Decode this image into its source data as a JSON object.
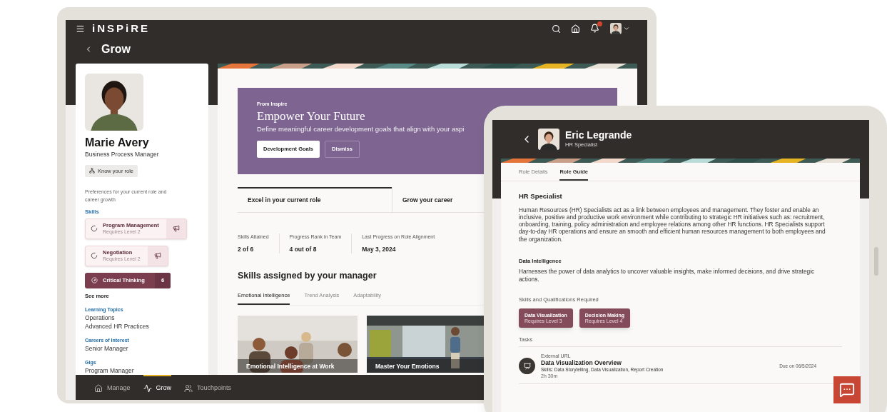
{
  "laptop": {
    "logo": "iNSPiRE",
    "page_title": "Grow",
    "profile": {
      "name": "Marie Avery",
      "job": "Business Process Manager",
      "role_button": "Know your role",
      "preferences_note": "Preferences for your current role and career growth",
      "skills_heading": "Skills",
      "skills": [
        {
          "kind": "pending",
          "name": "Program Management",
          "requirement": "Requires Level 2"
        },
        {
          "kind": "pending",
          "name": "Negotiation",
          "requirement": "Requires Level 2"
        },
        {
          "kind": "attained",
          "name": "Critical Thinking",
          "count": "6"
        }
      ],
      "see_more": "See more",
      "sections": [
        {
          "heading": "Learning Topics",
          "items": [
            "Operations",
            "Advanced HR Practices"
          ]
        },
        {
          "heading": "Careers of Interest",
          "items": [
            "Senior Manager"
          ]
        },
        {
          "heading": "Gigs",
          "items": [
            "Program Manager"
          ]
        }
      ]
    },
    "banner": {
      "eyebrow": "From Inspire",
      "title": "Empower Your Future",
      "text": "Define meaningful career development goals that align with your aspi",
      "primary_button": "Development Goals",
      "secondary_button": "Dismiss"
    },
    "role_tabs": [
      {
        "label": "Excel in your current role",
        "selected": true
      },
      {
        "label": "Grow your career",
        "selected": false
      }
    ],
    "stats": [
      {
        "label": "Skills Attained",
        "value": "2 of 6"
      },
      {
        "label": "Progress Rank in Team",
        "value": "4 out of 8"
      },
      {
        "label": "Last Progress on Role Alignment",
        "value": "May 3, 2024"
      }
    ],
    "skills_heading": "Skills assigned by your manager",
    "skill_tabs": [
      {
        "label": "Emotional Intelligence",
        "selected": true
      },
      {
        "label": "Trend Analysis",
        "selected": false
      },
      {
        "label": "Adaptability",
        "selected": false
      }
    ],
    "courses": [
      {
        "title": "Emotional Intelligence at Work"
      },
      {
        "title": "Master Your Emotions"
      }
    ],
    "bottom_nav": [
      {
        "kind": "manage",
        "label": "Manage",
        "selected": false
      },
      {
        "kind": "grow",
        "label": "Grow",
        "selected": true
      },
      {
        "kind": "touchpoints",
        "label": "Touchpoints",
        "selected": false
      }
    ]
  },
  "tablet": {
    "name": "Eric Legrande",
    "job": "HR Specialist",
    "tabs": [
      {
        "label": "Role Details",
        "selected": false
      },
      {
        "label": "Role Guide",
        "selected": true
      }
    ],
    "role_title": "HR Specialist",
    "role_description": "Human Resources (HR) Specialists act as a link between employees and management. They foster and enable an inclusive, positive and productive work environment while contributing to strategic HR initiatives such as: recruitment, onboarding, training, policy administration and employee relations among other HR functions. HR Specialists support day-to-day HR operations and ensure an smooth and efficient human resources management to both employees and the organization.",
    "sections": [
      {
        "heading": "Data Intelligence",
        "text": "Harnesses the power of data analytics to uncover valuable insights, make informed decisions, and drive strategic actions."
      }
    ],
    "skills_heading": "Skills and Qualifications Required",
    "skills": [
      {
        "name": "Data Visualization",
        "requirement": "Requires Level 3"
      },
      {
        "name": "Decision Making",
        "requirement": "Requires Level 4"
      }
    ],
    "tasks_heading": "Tasks",
    "tasks": [
      {
        "type": "External URL",
        "title": "Data Visualization Overview",
        "skills": "Skills: Data Storytelling, Data Visualization, Report Creation",
        "duration": "2h 30m",
        "due": "Due on 06/5/2024"
      }
    ]
  }
}
